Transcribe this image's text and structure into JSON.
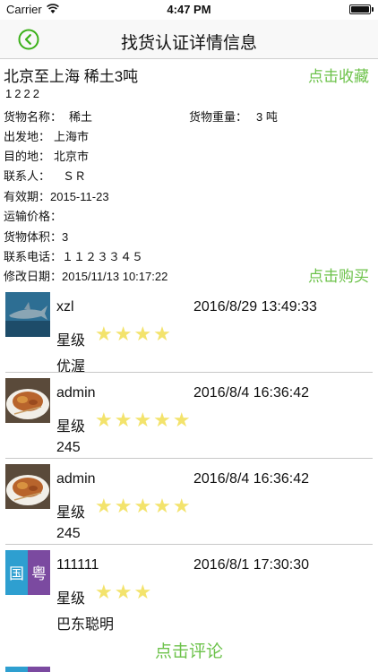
{
  "status": {
    "carrier": "Carrier",
    "time": "4:47 PM"
  },
  "nav": {
    "title": "找货认证详情信息"
  },
  "detail": {
    "title": "北京至上海 稀土3吨",
    "collect_label": "点击收藏",
    "code": "1222",
    "goods_name_label": "货物名称：",
    "goods_name": "稀土",
    "weight_label": "货物重量：",
    "weight": "3 吨",
    "origin_label": "出发地：",
    "origin": "上海市",
    "destination_label": "目的地：",
    "destination": "北京市",
    "contact_label": "联系人：",
    "contact": "ＳＲ",
    "validity_label": "有效期：",
    "validity": "2015-11-23",
    "price_label": "运输价格：",
    "price": "",
    "volume_label": "货物体积：",
    "volume": "3",
    "phone_label": "联系电话：",
    "phone": "１１２３３４５",
    "modified_label": "修改日期：",
    "modified": "2015/11/13 10:17:22",
    "buy_label": "点击购买"
  },
  "comments": [
    {
      "name": "xzl",
      "date": "2016/8/29 13:49:33",
      "rating_label": "星级",
      "stars": "★★★★",
      "rating": 4,
      "text": "优渥",
      "avatar": "shark-avatar"
    },
    {
      "name": "admin",
      "date": "2016/8/4 16:36:42",
      "rating_label": "星级",
      "stars": "★★★★★",
      "rating": 5,
      "text": "245",
      "avatar": "food-avatar"
    },
    {
      "name": "admin",
      "date": "2016/8/4 16:36:42",
      "rating_label": "星级",
      "stars": "★★★★★",
      "rating": 5,
      "text": "245",
      "avatar": "food-avatar"
    },
    {
      "name": "111111",
      "date": "2016/8/1 17:30:30",
      "rating_label": "星级",
      "stars": "★★★",
      "rating": 3,
      "text": "巴东聪明",
      "avatar": "guoyue-avatar",
      "avatar_chars": [
        "国",
        "粤"
      ]
    }
  ],
  "comment_link": "点击评论",
  "colors": {
    "accent": "#6cc24a",
    "star": "#f3e36c"
  }
}
